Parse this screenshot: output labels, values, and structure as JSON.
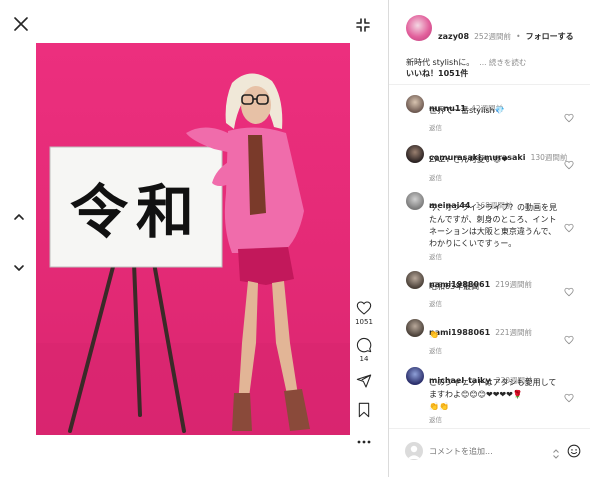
{
  "post": {
    "username": "zazy08",
    "time": "252週間前",
    "separator": "•",
    "follow_label": "フォローする",
    "caption": "新時代 stylishに。",
    "more_label": "... 続きを読む",
    "likes_text": "いいね！1051件",
    "sign_text": "令和"
  },
  "actions": {
    "like_count": "1051",
    "comment_count": "14"
  },
  "comments": [
    {
      "user": "nu.nu11",
      "time": "42週間前",
      "text_lines": [
        "世界で一番stylish💎"
      ],
      "reply": "返信"
    },
    {
      "user": "comurasaki.murasaki",
      "time": "130週間前",
      "text_lines": [
        "ZAZY さん可愛い😊❤"
      ],
      "reply": "返信"
    },
    {
      "user": "meinai44",
      "time": "168週間前",
      "text_lines": [
        "今、オンラインライブ？の動画を見",
        "たんですが、刺身のところ、イント",
        "ネーションは大阪と東京違うんで、",
        "わかりにくいですぅー。"
      ],
      "reply": "返信"
    },
    {
      "user": "nami1988061",
      "time": "219週間前",
      "text_lines": [
        "昭和63年最高"
      ],
      "reply": "返信"
    },
    {
      "user": "nami1988061",
      "time": "221週間前",
      "text_lines": [
        "👏"
      ],
      "reply": "返信"
    },
    {
      "user": "michael_taiky",
      "time": "230週間前",
      "text_lines": [
        "このジャケットはアタシも愛用して",
        "ますわよ😊😊😊❤❤❤❤🌹"
      ],
      "reply_line": "👏👏",
      "reply": "返信"
    }
  ],
  "input": {
    "placeholder": "コメントを追加..."
  }
}
